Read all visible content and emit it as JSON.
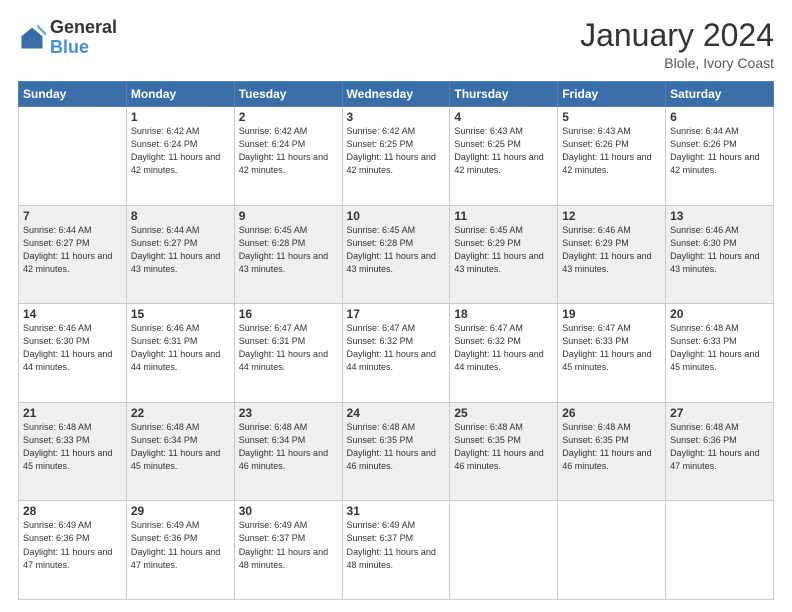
{
  "header": {
    "logo_line1": "General",
    "logo_line2": "Blue",
    "month": "January 2024",
    "location": "Blole, Ivory Coast"
  },
  "weekdays": [
    "Sunday",
    "Monday",
    "Tuesday",
    "Wednesday",
    "Thursday",
    "Friday",
    "Saturday"
  ],
  "weeks": [
    [
      {
        "day": "",
        "sunrise": "",
        "sunset": "",
        "daylight": ""
      },
      {
        "day": "1",
        "sunrise": "Sunrise: 6:42 AM",
        "sunset": "Sunset: 6:24 PM",
        "daylight": "Daylight: 11 hours and 42 minutes."
      },
      {
        "day": "2",
        "sunrise": "Sunrise: 6:42 AM",
        "sunset": "Sunset: 6:24 PM",
        "daylight": "Daylight: 11 hours and 42 minutes."
      },
      {
        "day": "3",
        "sunrise": "Sunrise: 6:42 AM",
        "sunset": "Sunset: 6:25 PM",
        "daylight": "Daylight: 11 hours and 42 minutes."
      },
      {
        "day": "4",
        "sunrise": "Sunrise: 6:43 AM",
        "sunset": "Sunset: 6:25 PM",
        "daylight": "Daylight: 11 hours and 42 minutes."
      },
      {
        "day": "5",
        "sunrise": "Sunrise: 6:43 AM",
        "sunset": "Sunset: 6:26 PM",
        "daylight": "Daylight: 11 hours and 42 minutes."
      },
      {
        "day": "6",
        "sunrise": "Sunrise: 6:44 AM",
        "sunset": "Sunset: 6:26 PM",
        "daylight": "Daylight: 11 hours and 42 minutes."
      }
    ],
    [
      {
        "day": "7",
        "sunrise": "Sunrise: 6:44 AM",
        "sunset": "Sunset: 6:27 PM",
        "daylight": "Daylight: 11 hours and 42 minutes."
      },
      {
        "day": "8",
        "sunrise": "Sunrise: 6:44 AM",
        "sunset": "Sunset: 6:27 PM",
        "daylight": "Daylight: 11 hours and 43 minutes."
      },
      {
        "day": "9",
        "sunrise": "Sunrise: 6:45 AM",
        "sunset": "Sunset: 6:28 PM",
        "daylight": "Daylight: 11 hours and 43 minutes."
      },
      {
        "day": "10",
        "sunrise": "Sunrise: 6:45 AM",
        "sunset": "Sunset: 6:28 PM",
        "daylight": "Daylight: 11 hours and 43 minutes."
      },
      {
        "day": "11",
        "sunrise": "Sunrise: 6:45 AM",
        "sunset": "Sunset: 6:29 PM",
        "daylight": "Daylight: 11 hours and 43 minutes."
      },
      {
        "day": "12",
        "sunrise": "Sunrise: 6:46 AM",
        "sunset": "Sunset: 6:29 PM",
        "daylight": "Daylight: 11 hours and 43 minutes."
      },
      {
        "day": "13",
        "sunrise": "Sunrise: 6:46 AM",
        "sunset": "Sunset: 6:30 PM",
        "daylight": "Daylight: 11 hours and 43 minutes."
      }
    ],
    [
      {
        "day": "14",
        "sunrise": "Sunrise: 6:46 AM",
        "sunset": "Sunset: 6:30 PM",
        "daylight": "Daylight: 11 hours and 44 minutes."
      },
      {
        "day": "15",
        "sunrise": "Sunrise: 6:46 AM",
        "sunset": "Sunset: 6:31 PM",
        "daylight": "Daylight: 11 hours and 44 minutes."
      },
      {
        "day": "16",
        "sunrise": "Sunrise: 6:47 AM",
        "sunset": "Sunset: 6:31 PM",
        "daylight": "Daylight: 11 hours and 44 minutes."
      },
      {
        "day": "17",
        "sunrise": "Sunrise: 6:47 AM",
        "sunset": "Sunset: 6:32 PM",
        "daylight": "Daylight: 11 hours and 44 minutes."
      },
      {
        "day": "18",
        "sunrise": "Sunrise: 6:47 AM",
        "sunset": "Sunset: 6:32 PM",
        "daylight": "Daylight: 11 hours and 44 minutes."
      },
      {
        "day": "19",
        "sunrise": "Sunrise: 6:47 AM",
        "sunset": "Sunset: 6:33 PM",
        "daylight": "Daylight: 11 hours and 45 minutes."
      },
      {
        "day": "20",
        "sunrise": "Sunrise: 6:48 AM",
        "sunset": "Sunset: 6:33 PM",
        "daylight": "Daylight: 11 hours and 45 minutes."
      }
    ],
    [
      {
        "day": "21",
        "sunrise": "Sunrise: 6:48 AM",
        "sunset": "Sunset: 6:33 PM",
        "daylight": "Daylight: 11 hours and 45 minutes."
      },
      {
        "day": "22",
        "sunrise": "Sunrise: 6:48 AM",
        "sunset": "Sunset: 6:34 PM",
        "daylight": "Daylight: 11 hours and 45 minutes."
      },
      {
        "day": "23",
        "sunrise": "Sunrise: 6:48 AM",
        "sunset": "Sunset: 6:34 PM",
        "daylight": "Daylight: 11 hours and 46 minutes."
      },
      {
        "day": "24",
        "sunrise": "Sunrise: 6:48 AM",
        "sunset": "Sunset: 6:35 PM",
        "daylight": "Daylight: 11 hours and 46 minutes."
      },
      {
        "day": "25",
        "sunrise": "Sunrise: 6:48 AM",
        "sunset": "Sunset: 6:35 PM",
        "daylight": "Daylight: 11 hours and 46 minutes."
      },
      {
        "day": "26",
        "sunrise": "Sunrise: 6:48 AM",
        "sunset": "Sunset: 6:35 PM",
        "daylight": "Daylight: 11 hours and 46 minutes."
      },
      {
        "day": "27",
        "sunrise": "Sunrise: 6:48 AM",
        "sunset": "Sunset: 6:36 PM",
        "daylight": "Daylight: 11 hours and 47 minutes."
      }
    ],
    [
      {
        "day": "28",
        "sunrise": "Sunrise: 6:49 AM",
        "sunset": "Sunset: 6:36 PM",
        "daylight": "Daylight: 11 hours and 47 minutes."
      },
      {
        "day": "29",
        "sunrise": "Sunrise: 6:49 AM",
        "sunset": "Sunset: 6:36 PM",
        "daylight": "Daylight: 11 hours and 47 minutes."
      },
      {
        "day": "30",
        "sunrise": "Sunrise: 6:49 AM",
        "sunset": "Sunset: 6:37 PM",
        "daylight": "Daylight: 11 hours and 48 minutes."
      },
      {
        "day": "31",
        "sunrise": "Sunrise: 6:49 AM",
        "sunset": "Sunset: 6:37 PM",
        "daylight": "Daylight: 11 hours and 48 minutes."
      },
      {
        "day": "",
        "sunrise": "",
        "sunset": "",
        "daylight": ""
      },
      {
        "day": "",
        "sunrise": "",
        "sunset": "",
        "daylight": ""
      },
      {
        "day": "",
        "sunrise": "",
        "sunset": "",
        "daylight": ""
      }
    ]
  ]
}
